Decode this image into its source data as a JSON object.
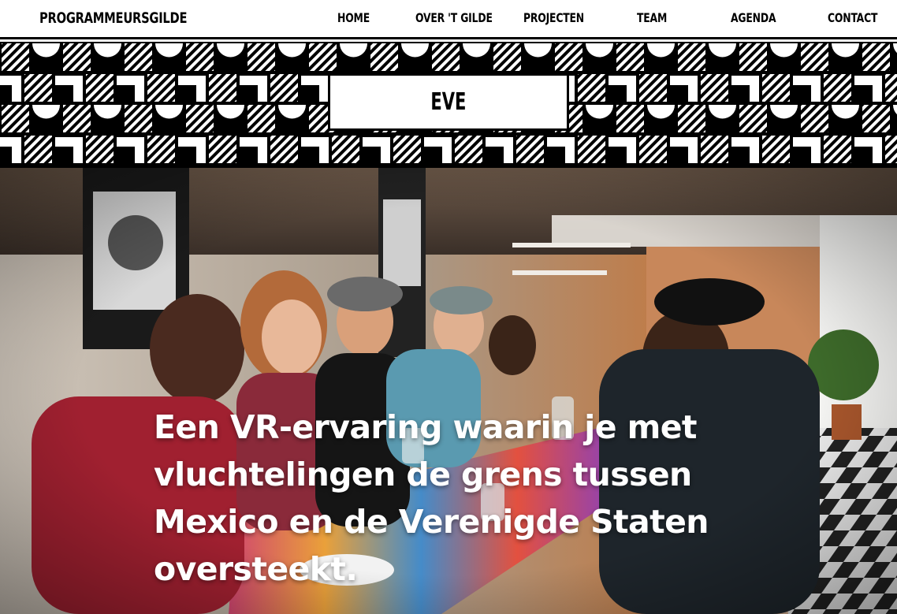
{
  "site": {
    "logo": "PROGRAMMEURSGILDE"
  },
  "nav": {
    "items": [
      {
        "label": "HOME"
      },
      {
        "label": "OVER 'T GILDE"
      },
      {
        "label": "PROJECTEN"
      },
      {
        "label": "TEAM"
      },
      {
        "label": "AGENDA"
      },
      {
        "label": "CONTACT"
      }
    ]
  },
  "banner": {
    "title": "EVE",
    "pattern_colors": {
      "dark": "#000000",
      "light": "#ffffff"
    }
  },
  "hero": {
    "tagline": "Een VR-ervaring waarin je met vluchtelingen de grens tussen Mexico en de Verenigde Staten oversteekt."
  }
}
